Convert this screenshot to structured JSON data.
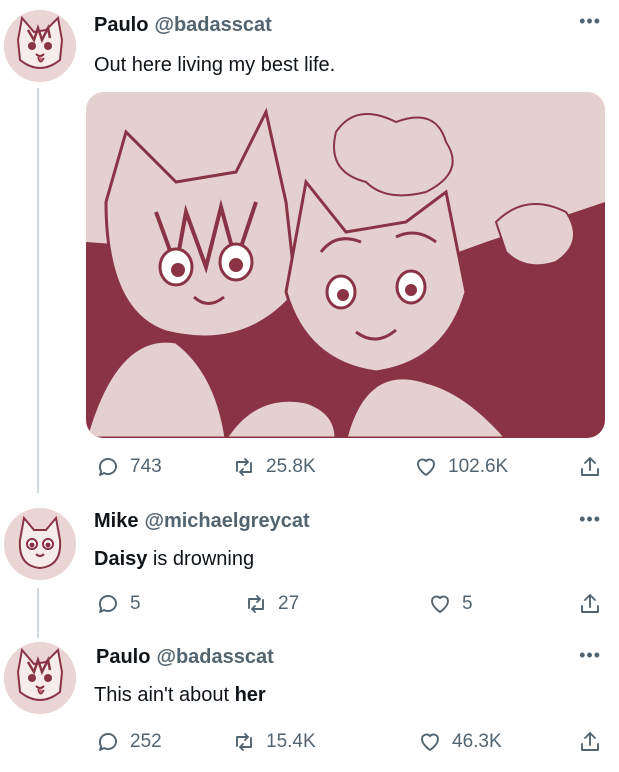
{
  "tweets": [
    {
      "name": "Paulo",
      "handle": "@badasscat",
      "text": "Out here living my best life.",
      "image_alt": "Two cartoon cats cuddling cheek to cheek",
      "stats": {
        "replies": "743",
        "retweets": "25.8K",
        "likes": "102.6K"
      }
    },
    {
      "name": "Mike",
      "handle": "@michaelgreycat",
      "text_bold": "Daisy",
      "text_rest": " is drowning",
      "stats": {
        "replies": "5",
        "retweets": "27",
        "likes": "5"
      }
    },
    {
      "name": "Paulo",
      "handle": "@badasscat",
      "text_plain": "This ain't about ",
      "text_bold": "her",
      "stats": {
        "replies": "252",
        "retweets": "15.4K",
        "likes": "46.3K"
      }
    }
  ],
  "icons": {
    "reply": "reply-icon",
    "retweet": "retweet-icon",
    "like": "heart-icon",
    "share": "share-icon",
    "more": "more-icon"
  },
  "colors": {
    "image_dark": "#8a3345",
    "image_light": "#e4d1cf",
    "handle_gray": "#536471",
    "thread_line": "#cfd9de"
  }
}
